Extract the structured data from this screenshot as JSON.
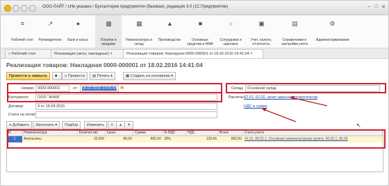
{
  "window": {
    "title": "ООО ЛАЙТ / сНе указано / Бухгалтерия предприятия (базовая), редакция 3.0 (1С:Предприятие)"
  },
  "ribbon": [
    {
      "label": "Рабочий стол",
      "icon": "home-icon"
    },
    {
      "label": "Руководителю",
      "icon": "chart-icon"
    },
    {
      "label": "Банк и касса",
      "icon": "bank-icon"
    },
    {
      "label": "Покупки и продажи",
      "icon": "cart-icon"
    },
    {
      "label": "Номенклатура и склад",
      "icon": "box-icon"
    },
    {
      "label": "Производство",
      "icon": "factory-icon"
    },
    {
      "label": "Основные средства и НМА",
      "icon": "assets-icon"
    },
    {
      "label": "Сотрудники и зарплата",
      "icon": "people-icon"
    },
    {
      "label": "Учет, налоги, отчетность",
      "icon": "tax-icon"
    },
    {
      "label": "Справочники и настройки учета",
      "icon": "book-icon"
    },
    {
      "label": "Администрирование",
      "icon": "gear-icon"
    }
  ],
  "tabs": [
    {
      "label": "Рабочий стол"
    },
    {
      "label": "Реализация (акты, накладные)"
    },
    {
      "label": "Реализация товаров: Накладная 0000-000001 от 18.02.2016 14:41:04"
    }
  ],
  "document": {
    "title": "Реализация товаров: Накладная 0000-000001 от 18.02.2016 14:41:04"
  },
  "toolbar": {
    "post_close": "Провести и закрыть",
    "post": "Провести",
    "print": "Печать",
    "create_based": "Создать на основании"
  },
  "form": {
    "number_label": "Номер:",
    "number_value": "0000-000001",
    "date_label": "от:",
    "date_value": "18.02.2016 14:41:04",
    "warehouse_label": "Склад:",
    "warehouse_value": "Основной склад",
    "counterparty_label": "Контрагент:",
    "counterparty_value": "ООО \"АНКА\"",
    "settlements_label": "Расчеты:",
    "settlements_value": "62.01, 62.02, зачет аванса автоматически",
    "contract_label": "Договор:",
    "contract_value": "б от 15.04.2015",
    "vat_link": "НДС в сумме",
    "invoice_label": "Счета на оплату:"
  },
  "table_toolbar": {
    "add": "Добавить",
    "fill": "Заполнить",
    "pick": "Подбор",
    "change": "Изменить"
  },
  "table": {
    "columns": [
      "N",
      "Номенклатура",
      "Количество",
      "Цена",
      "Сумма",
      "% НДС",
      "НДС",
      "Всего",
      "Счета учета"
    ],
    "rows": [
      [
        "1",
        "Апельсины",
        "10,000",
        "85,00",
        "850,00",
        "18%",
        "129,66",
        "850,00",
        "41.01, 90.01.1, Основная номенклатурная группа, 90.02.1, 90.03"
      ]
    ]
  }
}
